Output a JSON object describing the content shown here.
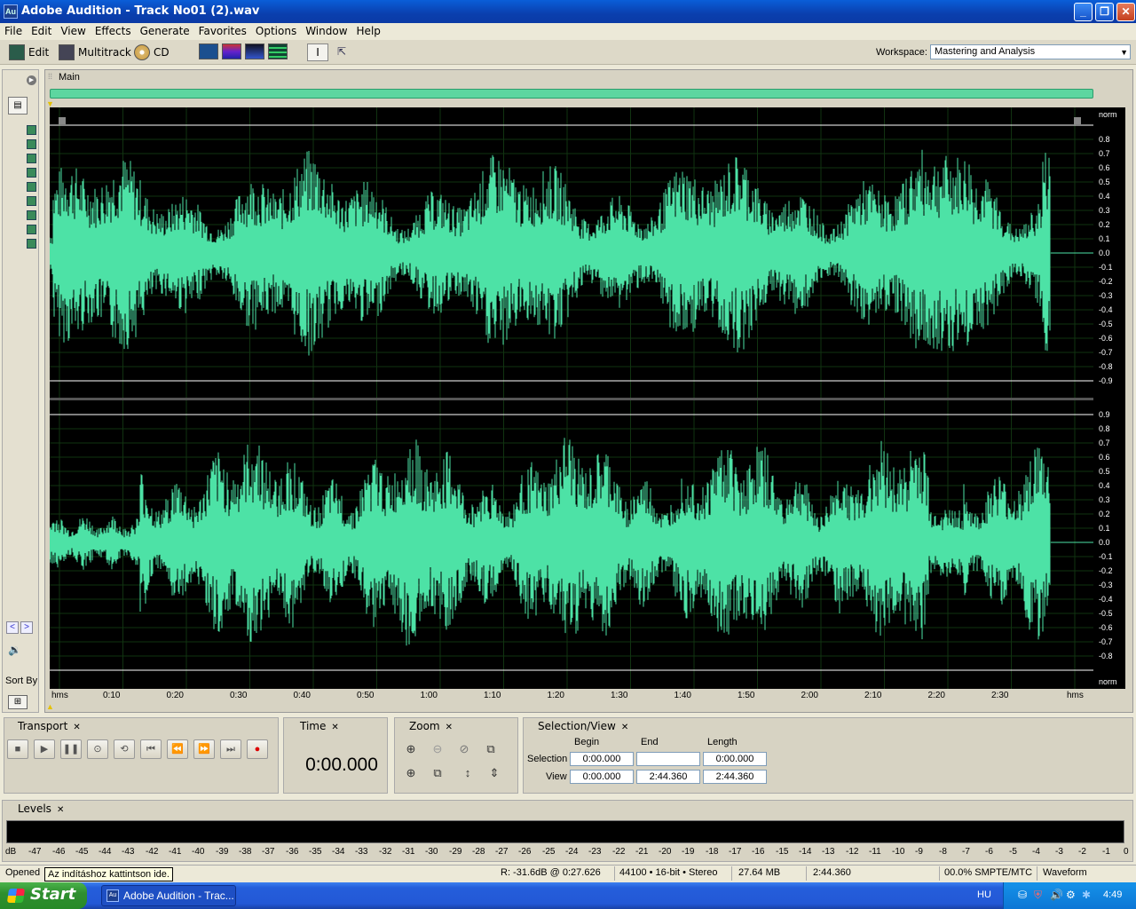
{
  "window": {
    "app_icon": "Au",
    "title": "Adobe Audition - Track No01 (2).wav"
  },
  "menu": [
    "File",
    "Edit",
    "View",
    "Effects",
    "Generate",
    "Favorites",
    "Options",
    "Window",
    "Help"
  ],
  "toolbar": {
    "edit_label": "Edit",
    "multitrack_label": "Multitrack",
    "cd_label": "CD",
    "workspace_label": "Workspace:",
    "workspace_value": "Mastering and Analysis"
  },
  "left_panel": {
    "sort_label": "Sort By"
  },
  "main_panel": {
    "tab_label": "Main",
    "norm_top": "norm",
    "norm_bottom": "norm",
    "amp_ticks_top": [
      "0.8",
      "0.7",
      "0.6",
      "0.5",
      "0.4",
      "0.3",
      "0.2",
      "0.1",
      "0.0",
      "-0.1",
      "-0.2",
      "-0.3",
      "-0.4",
      "-0.5",
      "-0.6",
      "-0.7",
      "-0.8",
      "-0.9"
    ],
    "amp_ticks_bottom": [
      "0.9",
      "0.8",
      "0.7",
      "0.6",
      "0.5",
      "0.4",
      "0.3",
      "0.2",
      "0.1",
      "0.0",
      "-0.1",
      "-0.2",
      "-0.3",
      "-0.4",
      "-0.5",
      "-0.6",
      "-0.7",
      "-0.8"
    ],
    "time_ticks": [
      "hms",
      "0:10",
      "0:20",
      "0:30",
      "0:40",
      "0:50",
      "1:00",
      "1:10",
      "1:20",
      "1:30",
      "1:40",
      "1:50",
      "2:00",
      "2:10",
      "2:20",
      "2:30",
      "hms"
    ],
    "waveform_color": "#4de2a6"
  },
  "transport": {
    "tab_label": "Transport"
  },
  "time_panel": {
    "tab_label": "Time",
    "display": "0:00.000"
  },
  "zoom_panel": {
    "tab_label": "Zoom"
  },
  "selection_view": {
    "tab_label": "Selection/View",
    "col_begin": "Begin",
    "col_end": "End",
    "col_length": "Length",
    "row_selection": "Selection",
    "row_view": "View",
    "selection_begin": "0:00.000",
    "selection_end": "",
    "selection_length": "0:00.000",
    "view_begin": "0:00.000",
    "view_end": "2:44.360",
    "view_length": "2:44.360"
  },
  "levels": {
    "tab_label": "Levels",
    "scale": [
      "dB",
      "-47",
      "-46",
      "-45",
      "-44",
      "-43",
      "-42",
      "-41",
      "-40",
      "-39",
      "-38",
      "-37",
      "-36",
      "-35",
      "-34",
      "-33",
      "-32",
      "-31",
      "-30",
      "-29",
      "-28",
      "-27",
      "-26",
      "-25",
      "-24",
      "-23",
      "-22",
      "-21",
      "-20",
      "-19",
      "-18",
      "-17",
      "-16",
      "-15",
      "-14",
      "-13",
      "-12",
      "-11",
      "-10",
      "-9",
      "-8",
      "-7",
      "-6",
      "-5",
      "-4",
      "-3",
      "-2",
      "-1",
      "0"
    ]
  },
  "status": {
    "opened": "Opened",
    "tooltip": "Az indításhoz kattintson ide.",
    "level_readout": "R: -31.6dB @   0:27.626",
    "format": "44100 • 16-bit • Stereo",
    "size": "27.64 MB",
    "duration": "2:44.360",
    "smpte": "00.0% SMPTE/MTC",
    "view_mode": "Waveform"
  },
  "taskbar": {
    "start_label": "Start",
    "task_label": "Adobe Audition - Trac...",
    "language": "HU",
    "clock": "4:49"
  }
}
